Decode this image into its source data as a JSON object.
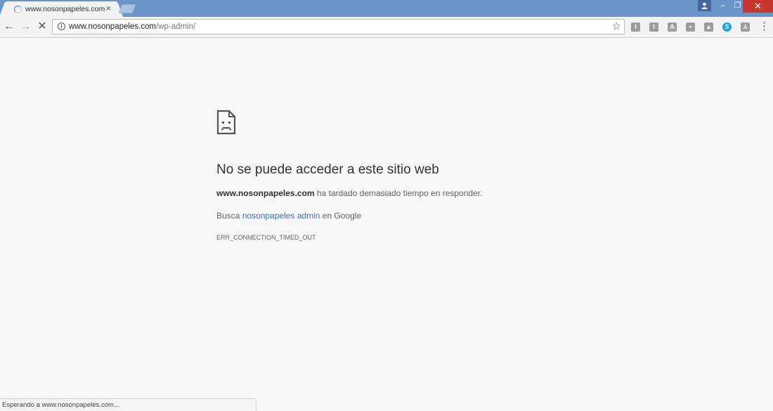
{
  "tab": {
    "title": "www.nosonpapeles.com",
    "close_glyph": "×"
  },
  "window_controls": {
    "minimize": "–",
    "maximize": "❐",
    "close": "✕"
  },
  "toolbar": {
    "back_glyph": "←",
    "forward_glyph": "→",
    "stop_glyph": "✕",
    "url_host": "www.nosonpapeles.com",
    "url_path": "/wp-admin/",
    "info_glyph": "i",
    "star_glyph": "☆",
    "menu_glyph": "⋮",
    "extensions": [
      {
        "icon": "i-box-icon",
        "glyph": "I"
      },
      {
        "icon": "i-box-icon-2",
        "glyph": "I"
      },
      {
        "icon": "a-box-icon",
        "glyph": "A"
      },
      {
        "icon": "image-icon",
        "glyph": "▪"
      },
      {
        "icon": "drive-icon",
        "glyph": "▲"
      },
      {
        "icon": "skype-icon",
        "glyph": "S"
      },
      {
        "icon": "pdf-icon",
        "glyph": "⅄"
      },
      {
        "icon": "puzzle-icon",
        "glyph": "■"
      }
    ]
  },
  "error": {
    "title": "No se puede acceder a este sitio web",
    "host": "www.nosonpapeles.com",
    "detail": " ha tardado demasiado tiempo en responder.",
    "search_prefix": "Busca ",
    "search_link": "nosonpapeles admin",
    "search_suffix": " en Google",
    "code": "ERR_CONNECTION_TIMED_OUT"
  },
  "status_text": "Esperando a www.nosonpapeles.com...",
  "colors": {
    "titlebar": "#6b95c9",
    "close_button": "#c7372f",
    "link": "#3d6fc6",
    "page_background": "#f7f7f7"
  }
}
